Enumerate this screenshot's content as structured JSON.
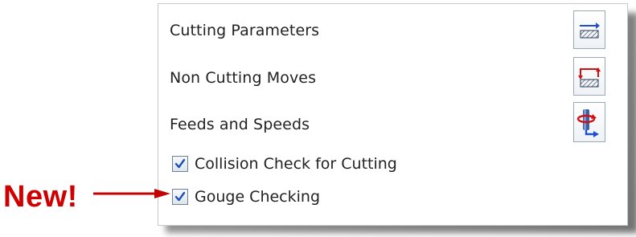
{
  "panel": {
    "rows": [
      {
        "label": "Cutting Parameters",
        "icon": "cutting-parameters-icon"
      },
      {
        "label": "Non Cutting Moves",
        "icon": "non-cutting-moves-icon"
      },
      {
        "label": "Feeds and Speeds",
        "icon": "feeds-and-speeds-icon"
      }
    ],
    "checkboxes": [
      {
        "label": "Collision Check for Cutting",
        "checked": true
      },
      {
        "label": "Gouge Checking",
        "checked": true
      }
    ]
  },
  "callout": {
    "text": "New!",
    "color": "#d00000"
  },
  "colors": {
    "icon_blue": "#1f4fd0",
    "icon_red": "#d01010",
    "check_blue": "#1d4fb8"
  }
}
